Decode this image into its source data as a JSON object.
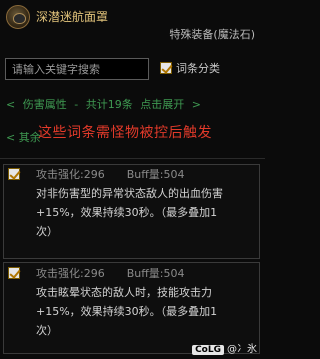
{
  "item": {
    "name": "深潜迷航面罩",
    "type": "特殊装备(魔法石)"
  },
  "search": {
    "placeholder": "请输入关键字搜索"
  },
  "filter": {
    "label": "词条分类",
    "checked": true
  },
  "expander": {
    "left_arrow": "<",
    "category": "伤害属性",
    "dash": "-",
    "count_text": "共计19条",
    "expand_label": "点击展开",
    "right_arrow": ">"
  },
  "row2": {
    "left_arrow": "<",
    "partial": "其余"
  },
  "overlay": {
    "text": "这些词条需怪物被控后触发"
  },
  "entries": [
    {
      "checked": true,
      "attack_label": "攻击强化:296",
      "buff_label": "Buff量:504",
      "desc_lines": [
        "对非伤害型的异常状态敌人的出血伤害",
        "+15%，效果持续30秒。（最多叠加1",
        "次）"
      ]
    },
    {
      "checked": true,
      "attack_label": "攻击强化:296",
      "buff_label": "Buff量:504",
      "desc_lines": [
        "攻击眩晕状态的敌人时，技能攻击力",
        "+15%，效果持续30秒。（最多叠加1",
        "次）"
      ]
    }
  ],
  "watermark": {
    "logo": "CoLG",
    "text": "@冫氷"
  }
}
